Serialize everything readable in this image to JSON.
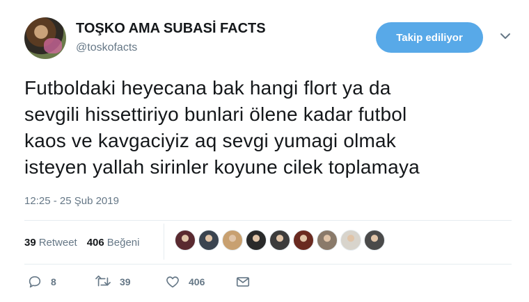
{
  "header": {
    "display_name": "TOŞKO AMA SUBASİ FACTS",
    "handle": "@toskofacts",
    "follow_button_label": "Takip ediliyor"
  },
  "tweet": {
    "lines": [
      "Futboldaki heyecana bak hangi flort ya da",
      "sevgili hissettiriyo bunlari ölene kadar futbol",
      "kaos ve kavgaciyiz aq sevgi yumagi olmak",
      "isteyen yallah sirinler koyune cilek toplamaya"
    ],
    "timestamp": "12:25 - 25 Şub 2019"
  },
  "stats": {
    "retweet_count": "39",
    "retweet_label": "Retweet",
    "like_count": "406",
    "like_label": "Beğeni"
  },
  "likers": [
    {
      "name": "liker-avatar-1",
      "color": "#5a2a30"
    },
    {
      "name": "liker-avatar-2",
      "color": "#3a4450"
    },
    {
      "name": "liker-avatar-3",
      "color": "#c8a070"
    },
    {
      "name": "liker-avatar-4",
      "color": "#2a2a2a"
    },
    {
      "name": "liker-avatar-5",
      "color": "#3c3c3c"
    },
    {
      "name": "liker-avatar-6",
      "color": "#6a2a20"
    },
    {
      "name": "liker-avatar-7",
      "color": "#8a7a6a"
    },
    {
      "name": "liker-avatar-8",
      "color": "#d8d4cc"
    },
    {
      "name": "liker-avatar-9",
      "color": "#4a4a4a"
    }
  ],
  "actions": {
    "reply_count": "8",
    "retweet_count": "39",
    "like_count": "406"
  },
  "colors": {
    "accent": "#58a9e8",
    "muted": "#657786",
    "divider": "#e6ecf0"
  },
  "icons": {
    "reply": "reply-icon",
    "retweet": "retweet-icon",
    "like": "heart-icon",
    "dm": "envelope-icon",
    "caret": "chevron-down-icon"
  }
}
